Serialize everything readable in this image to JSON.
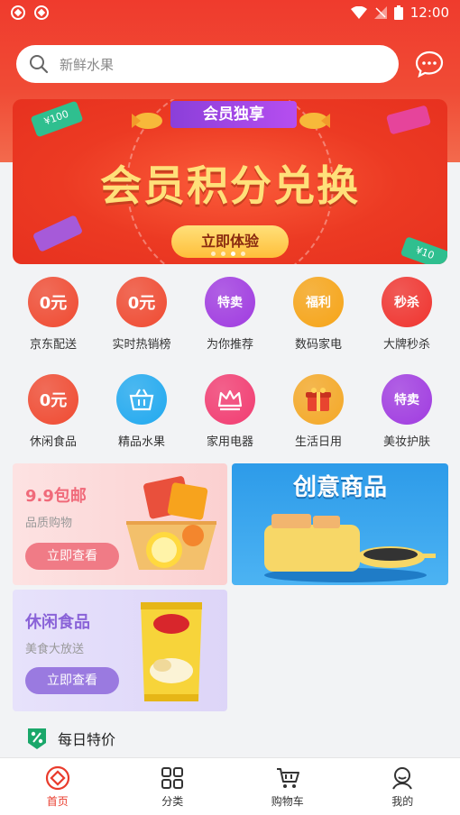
{
  "status_bar": {
    "time": "12:00"
  },
  "search": {
    "placeholder": "新鲜水果"
  },
  "banner": {
    "tag": "会员独享",
    "headline": "会员积分兑换",
    "cta": "立即体验",
    "deco_left": "¥100",
    "deco_right": "¥10"
  },
  "grid": [
    {
      "label": "京东配送",
      "badge": "0元",
      "color": "#f04a31"
    },
    {
      "label": "实时热销榜",
      "badge": "0元",
      "color": "#f04a31"
    },
    {
      "label": "为你推荐",
      "badge": "特卖",
      "color": "#a03be0"
    },
    {
      "label": "数码家电",
      "badge": "福利",
      "color": "#f6a417"
    },
    {
      "label": "大牌秒杀",
      "badge": "秒杀",
      "color": "#f0332e"
    },
    {
      "label": "休闲食品",
      "badge": "0元",
      "color": "#f04a31"
    },
    {
      "label": "精品水果",
      "badge": "",
      "color": "#21a9ef"
    },
    {
      "label": "家用电器",
      "badge": "",
      "color": "#f23c71"
    },
    {
      "label": "生活日用",
      "badge": "",
      "color": "#f4a826"
    },
    {
      "label": "美妆护肤",
      "badge": "特卖",
      "color": "#a03be0"
    }
  ],
  "promo": {
    "card1": {
      "title": "9.9包邮",
      "subtitle": "品质购物",
      "button": "立即查看"
    },
    "card2": {
      "title": "创意商品"
    },
    "card3": {
      "title": "休闲食品",
      "subtitle": "美食大放送",
      "button": "立即查看"
    }
  },
  "daily": {
    "title": "每日特价"
  },
  "bottom_nav": [
    {
      "label": "首页"
    },
    {
      "label": "分类"
    },
    {
      "label": "购物车"
    },
    {
      "label": "我的"
    }
  ]
}
